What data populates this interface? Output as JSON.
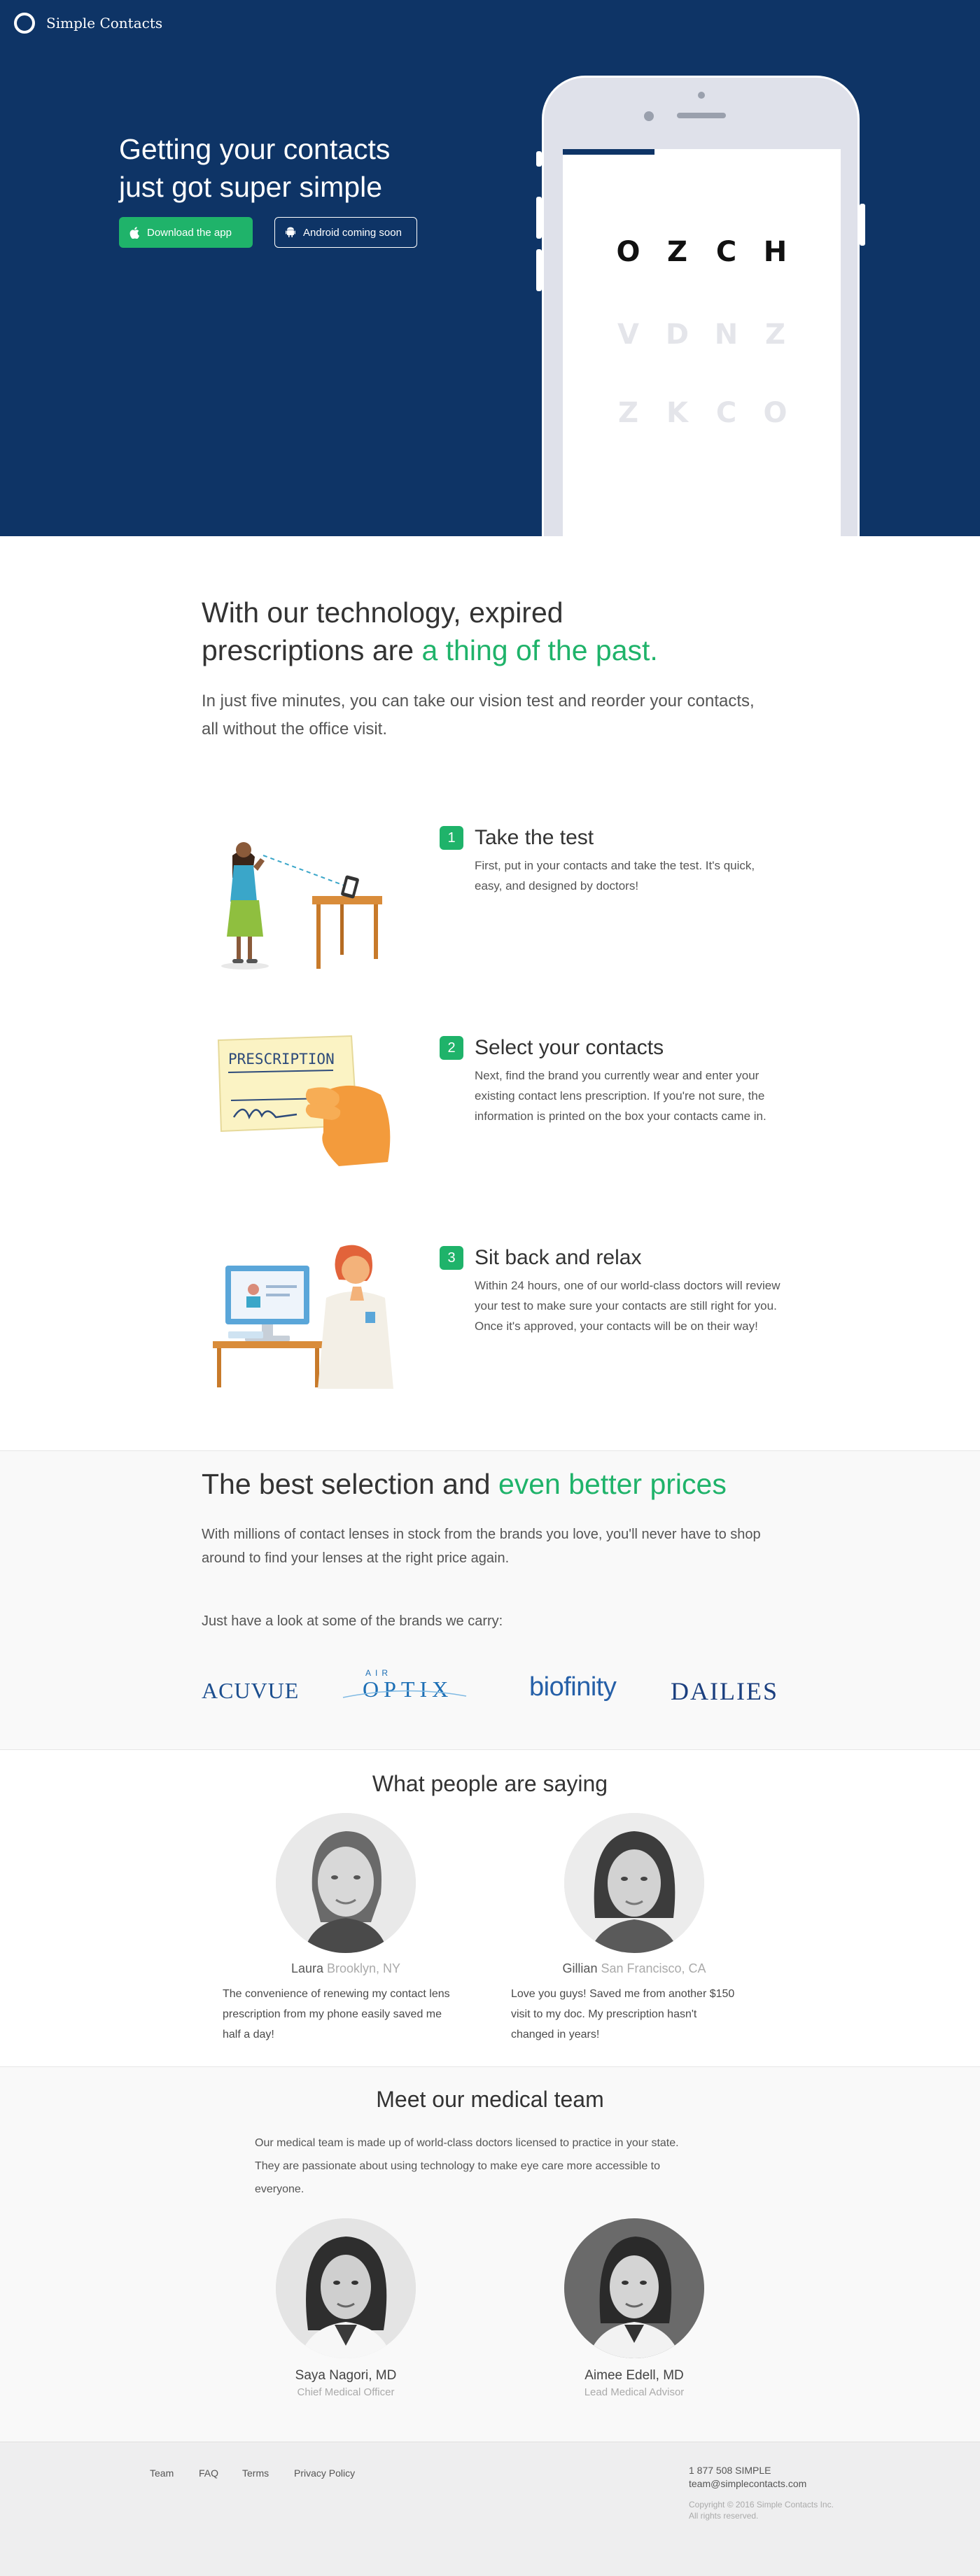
{
  "header": {
    "brand_name": "Simple Contacts",
    "logo_icon": "ring-logo-icon"
  },
  "hero": {
    "title_line1": "Getting your contacts",
    "title_line2": "just got super simple",
    "ios_button": "Download the app",
    "ios_icon": "apple-icon",
    "android_button": "Android coming soon",
    "android_icon": "android-icon",
    "background_color": "#0e3466",
    "accent_color": "#1fb36a",
    "phone": {
      "progress_fraction": 0.33,
      "rows": [
        [
          "O",
          "Z",
          "C",
          "H"
        ],
        [
          "V",
          "D",
          "N",
          "Z"
        ],
        [
          "Z",
          "K",
          "C",
          "O"
        ]
      ]
    }
  },
  "tech": {
    "title_line1": "With our technology, expired",
    "title_line2_plain": "prescriptions are ",
    "title_line2_accent": "a thing of the past.",
    "text": "In just five minutes, you can take our vision test and reorder your contacts, all without the office visit."
  },
  "steps": [
    {
      "number": "1",
      "title": "Take the test",
      "text": "First, put in your contacts and take the test. It's quick, easy, and designed by doctors!"
    },
    {
      "number": "2",
      "title": "Select your contacts",
      "text": "Next, find the brand you currently wear and enter your existing contact lens prescription. If you're not sure, the information is printed on the box your contacts came in.",
      "card_label": "PRESCRIPTION"
    },
    {
      "number": "3",
      "title": "Sit back and relax",
      "text": "Within 24 hours, one of our world-class doctors will review your test to make sure your contacts are still right for you. Once it's approved, your contacts will be on their way!"
    }
  ],
  "selection": {
    "title_plain": "The best selection and ",
    "title_accent": "even better prices",
    "text": "With millions of contact lenses in stock from the brands you love, you'll never have to shop around to find your lenses at the right price again.",
    "subtext": "Just have a look at some of the brands we carry:",
    "brands": {
      "acuvue": "ACUVUE",
      "air": "AIR",
      "optix": "OPTIX",
      "biofinity": "biofinity",
      "dailies": "DAILIES"
    }
  },
  "testimonials": {
    "title": "What people are saying",
    "items": [
      {
        "name": "Laura",
        "location": "Brooklyn, NY",
        "quote_lines": [
          "The convenience of renewing my contact lens",
          "prescription from my phone easily saved me",
          "half a day!"
        ]
      },
      {
        "name": "Gillian",
        "location": "San Francisco, CA",
        "quote_lines": [
          "Love you guys! Saved me from another $150",
          "visit to my doc. My prescription hasn't",
          "changed in years!"
        ]
      }
    ]
  },
  "medical": {
    "title": "Meet our medical team",
    "text_lines": [
      "Our medical team is made up of world-class doctors licensed to practice in your state.",
      "They are passionate about using technology to make eye care more accessible to",
      "everyone."
    ],
    "doctors": [
      {
        "name": "Saya Nagori, MD",
        "role": "Chief Medical Officer"
      },
      {
        "name": "Aimee Edell, MD",
        "role": "Lead Medical Advisor"
      }
    ]
  },
  "footer": {
    "links": [
      "Team",
      "FAQ",
      "Terms",
      "Privacy Policy"
    ],
    "phone": "1 877 508 SIMPLE",
    "email": "team@simplecontacts.com",
    "copyright": "Copyright © 2016 Simple Contacts Inc.",
    "rights": "All rights reserved."
  }
}
